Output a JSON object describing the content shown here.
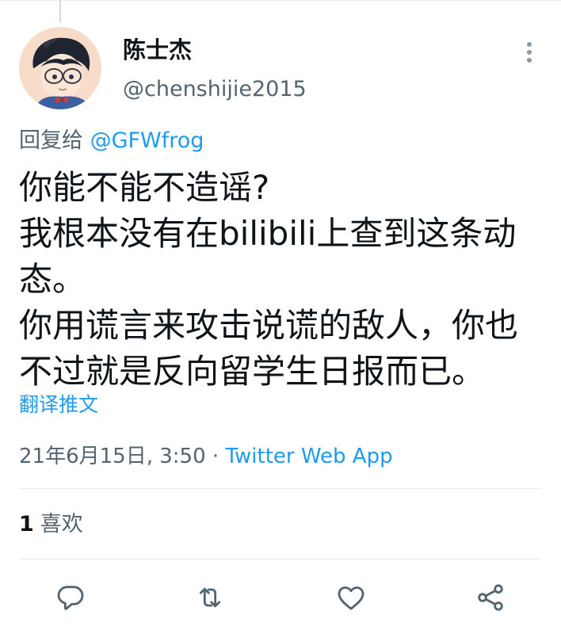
{
  "tweet": {
    "author": {
      "display_name": "陈士杰",
      "handle": "@chenshijie2015"
    },
    "reply_to": {
      "prefix": "回复给",
      "mention": "@GFWfrog"
    },
    "text_lines": [
      "你能不能不造谣?",
      "我根本没有在bilibili上查到这条动",
      "态。",
      "你用谎言来攻击说谎的敌人，你也",
      "不过就是反向留学生日报而已。"
    ],
    "translate_label": "翻译推文",
    "timestamp": "21年6月15日, 3:50",
    "separator": " · ",
    "source": "Twitter Web App",
    "likes": {
      "count": "1",
      "label": "喜欢"
    }
  },
  "icons": {
    "more": "more-vertical-icon",
    "reply": "reply-icon",
    "retweet": "retweet-icon",
    "like": "heart-icon",
    "share": "share-icon"
  },
  "colors": {
    "accent": "#1d9bf0",
    "text_primary": "#0f1419",
    "text_secondary": "#536471",
    "divider": "#e6ecf0",
    "icon": "#536471"
  }
}
